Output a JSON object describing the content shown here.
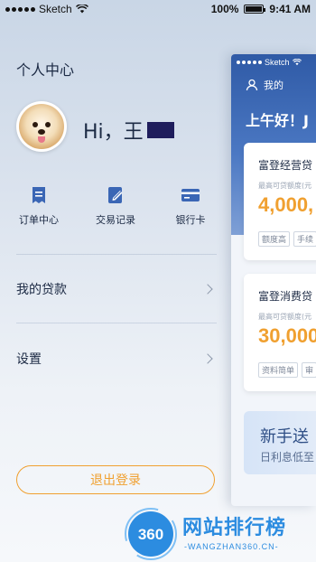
{
  "status_bar": {
    "carrier": "Sketch",
    "battery": "100%",
    "battery_level": 1.0,
    "time": "9:41 AM"
  },
  "drawer": {
    "title": "个人中心",
    "greeting": "Hi，王",
    "menu": [
      {
        "label": "订单中心",
        "icon": "order-icon"
      },
      {
        "label": "交易记录",
        "icon": "transaction-record-icon"
      },
      {
        "label": "银行卡",
        "icon": "bank-card-icon"
      }
    ],
    "list": [
      {
        "label": "我的贷款"
      },
      {
        "label": "设置"
      }
    ],
    "logout_label": "退出登录"
  },
  "preview": {
    "carrier": "Sketch",
    "user_label": "我的",
    "hello": "上午好！J",
    "cards": [
      {
        "title": "富登经营贷",
        "subtitle": "最高可贷额度(元",
        "value": "4,000,",
        "tags": [
          "额度高",
          "手续"
        ]
      },
      {
        "title": "富登消费贷",
        "subtitle": "最高可贷额度(元",
        "value": "30,000",
        "tags": [
          "资料简单",
          "审"
        ]
      }
    ],
    "promo_title": "新手送",
    "promo_subtitle": "日利息低至"
  },
  "watermark": {
    "logo_text": "360",
    "text": "网站排行榜",
    "sub": "-WANGZHAN360.CN-"
  },
  "colors": {
    "accent_orange": "#f0a030",
    "brand_blue": "#2f5aa6",
    "text_dark": "#1c2a44"
  }
}
